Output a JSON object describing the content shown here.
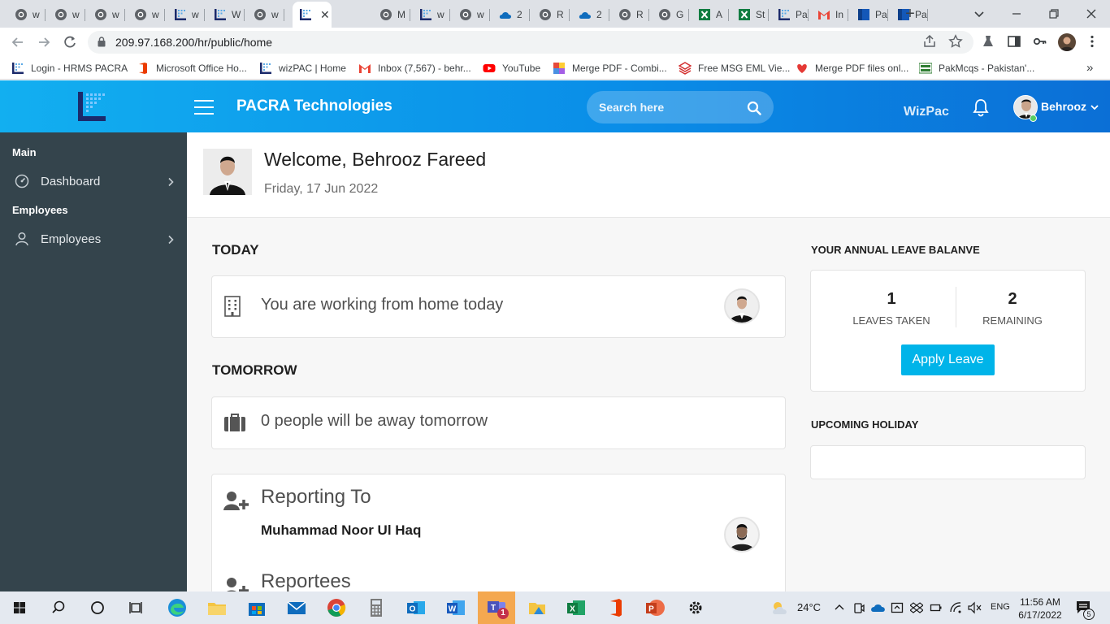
{
  "browser": {
    "tabs": [
      {
        "title": "w",
        "favicon": "globe-icon"
      },
      {
        "title": "w",
        "favicon": "globe-icon"
      },
      {
        "title": "w",
        "favicon": "globe-icon"
      },
      {
        "title": "w",
        "favicon": "globe-icon"
      },
      {
        "title": "w",
        "favicon": "pacra-icon"
      },
      {
        "title": "W",
        "favicon": "pacra-icon"
      },
      {
        "title": "w",
        "favicon": "globe-icon"
      },
      {
        "title": "",
        "favicon": "pacra-icon",
        "active": true
      },
      {
        "title": "M",
        "favicon": "globe-icon"
      },
      {
        "title": "w",
        "favicon": "pacra-icon"
      },
      {
        "title": "w",
        "favicon": "globe-icon"
      },
      {
        "title": "2",
        "favicon": "onedrive-icon"
      },
      {
        "title": "R",
        "favicon": "globe-icon"
      },
      {
        "title": "2",
        "favicon": "onedrive-icon"
      },
      {
        "title": "R",
        "favicon": "globe-icon"
      },
      {
        "title": "G",
        "favicon": "globe-icon"
      },
      {
        "title": "A",
        "favicon": "excel-icon"
      },
      {
        "title": "St",
        "favicon": "excel-icon"
      },
      {
        "title": "Pa",
        "favicon": "pacra-icon"
      },
      {
        "title": "In",
        "favicon": "gmail-icon"
      },
      {
        "title": "Pa",
        "favicon": "blue-square-icon"
      },
      {
        "title": "Pa",
        "favicon": "blue-square-icon"
      }
    ],
    "url": "209.97.168.200/hr/public/home",
    "bookmarks": [
      {
        "label": "Login - HRMS PACRA",
        "icon": "pacra-icon"
      },
      {
        "label": "Microsoft Office Ho...",
        "icon": "office-icon"
      },
      {
        "label": "wizPAC | Home",
        "icon": "pacra-icon"
      },
      {
        "label": "Inbox (7,567) - behr...",
        "icon": "gmail-icon"
      },
      {
        "label": "YouTube",
        "icon": "youtube-icon"
      },
      {
        "label": "Merge PDF - Combi...",
        "icon": "pdf-merge-icon"
      },
      {
        "label": "Free MSG EML Vie...",
        "icon": "layers-icon"
      },
      {
        "label": "Merge PDF files onl...",
        "icon": "heart-icon"
      },
      {
        "label": "PakMcqs - Pakistan'...",
        "icon": "pakmcqs-icon"
      }
    ],
    "more_bookmarks": "»"
  },
  "header": {
    "brand": "PACRA Technologies",
    "search_placeholder": "Search here",
    "wizpac": "WizPac",
    "user_name": "Behrooz"
  },
  "sidebar": {
    "main_heading": "Main",
    "dashboard": "Dashboard",
    "employees_heading": "Employees",
    "employees": "Employees"
  },
  "welcome": {
    "title": "Welcome, Behrooz Fareed",
    "date": "Friday, 17 Jun 2022"
  },
  "today": {
    "heading": "TODAY",
    "message": "You are working from home today"
  },
  "tomorrow": {
    "heading": "TOMORROW",
    "message": "0 people will be away tomorrow"
  },
  "reporting": {
    "heading": "Reporting To",
    "manager": "Muhammad Noor Ul Haq",
    "reportees_heading": "Reportees"
  },
  "leave": {
    "heading": "YOUR ANNUAL LEAVE BALANVE",
    "taken_value": "1",
    "taken_label": "LEAVES TAKEN",
    "remaining_value": "2",
    "remaining_label": "REMAINING",
    "apply_button": "Apply Leave"
  },
  "holiday": {
    "heading": "UPCOMING HOLIDAY"
  },
  "taskbar": {
    "temperature": "24°C",
    "language": "ENG",
    "time": "11:56 AM",
    "date": "6/17/2022",
    "notifications": "5",
    "teams_badge": "1"
  }
}
